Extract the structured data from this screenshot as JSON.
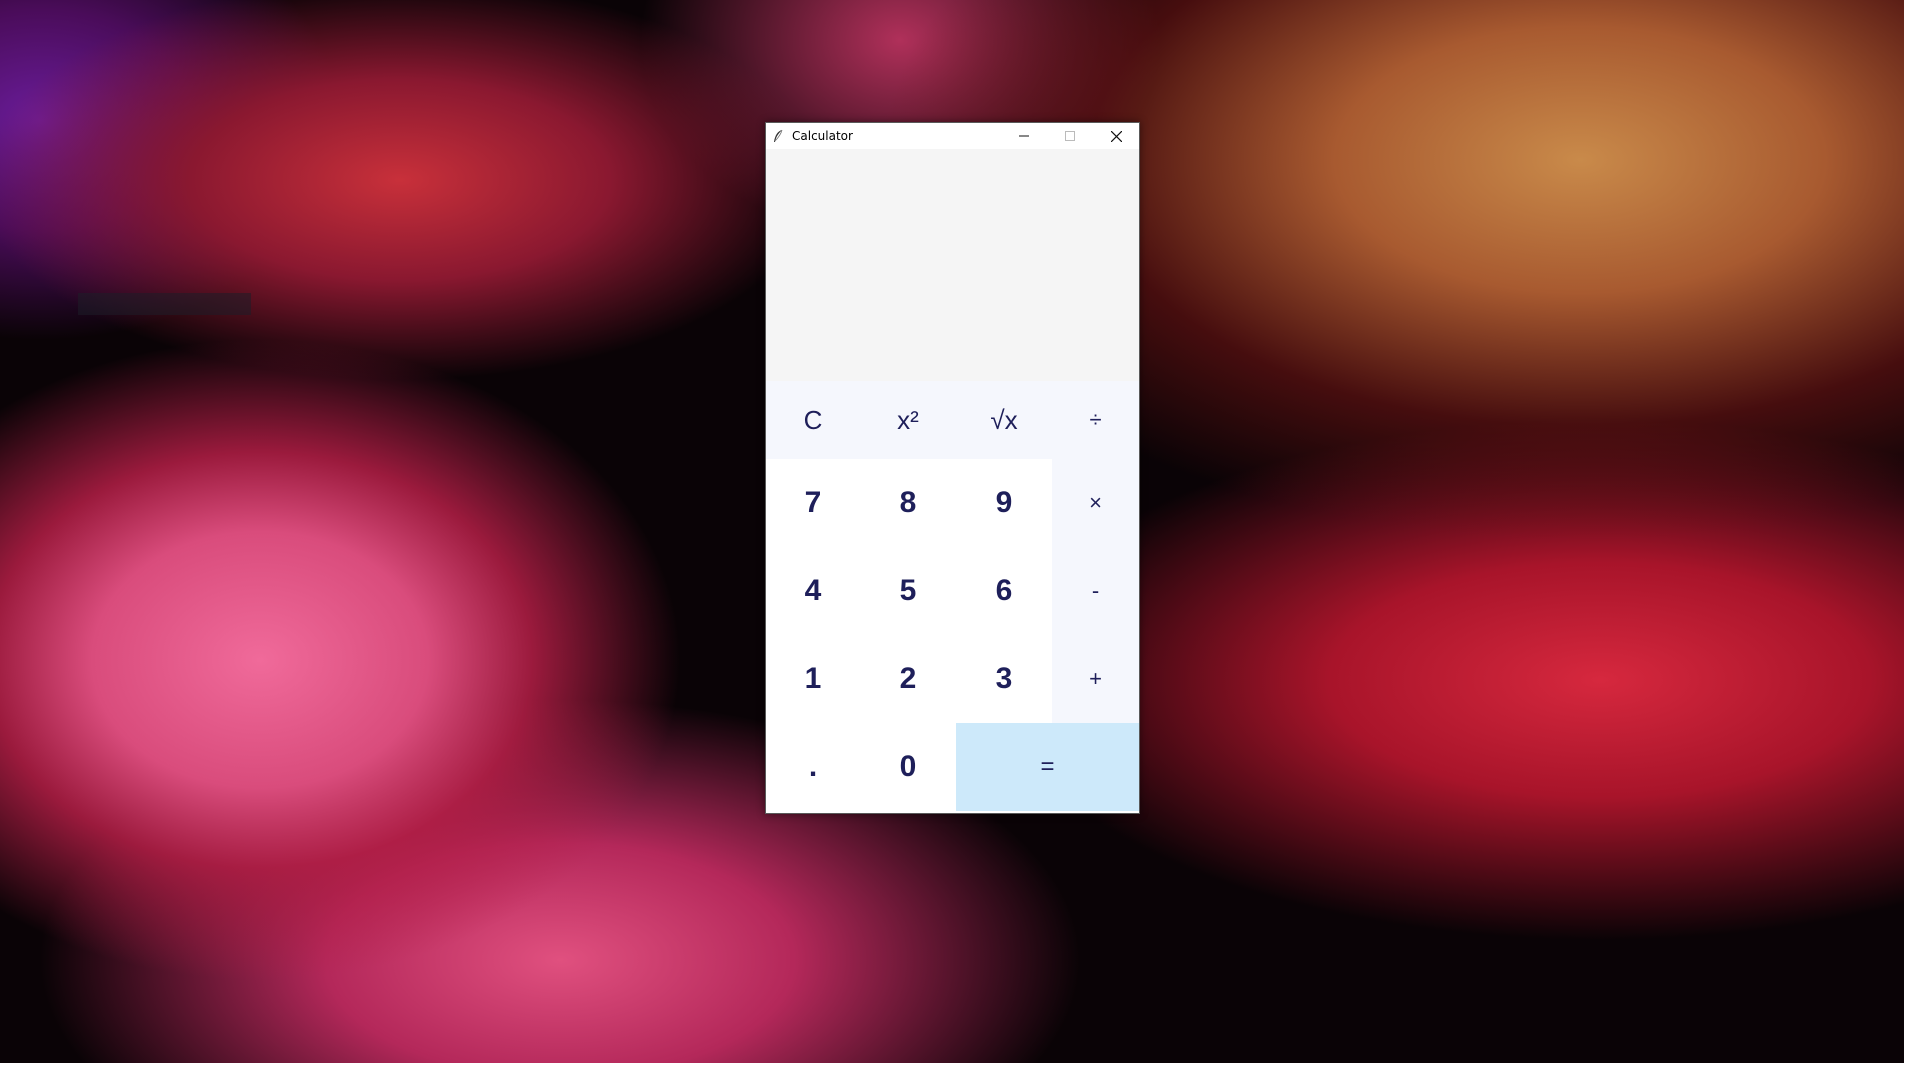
{
  "window": {
    "title": "Calculator",
    "icon": "feather-icon",
    "controls": [
      "minimize-icon",
      "maximize-icon",
      "close-icon"
    ]
  },
  "display": {
    "value": ""
  },
  "keys": {
    "clear": "C",
    "square": "x²",
    "sqrt": "√x",
    "divide": "÷",
    "multiply": "×",
    "subtract": "-",
    "add": "+",
    "equals": "=",
    "decimal": ".",
    "d0": "0",
    "d1": "1",
    "d2": "2",
    "d3": "3",
    "d4": "4",
    "d5": "5",
    "d6": "6",
    "d7": "7",
    "d8": "8",
    "d9": "9"
  },
  "colors": {
    "key_text": "#1e1f5a",
    "equals_bg": "#cde9fa",
    "function_bg": "#f5f7fd",
    "display_bg": "#f5f5f5"
  }
}
